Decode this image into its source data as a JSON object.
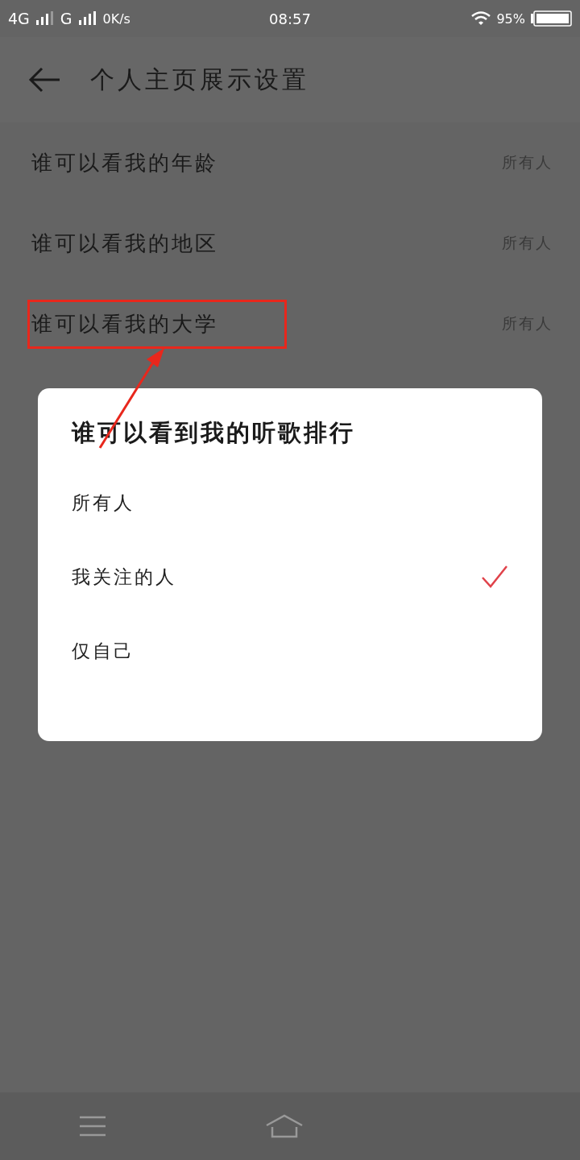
{
  "status_bar": {
    "network_1": "4G",
    "network_2": "G",
    "speed": "0K/s",
    "time": "08:57",
    "battery": "95%"
  },
  "header": {
    "title": "个人主页展示设置"
  },
  "rows": [
    {
      "label": "谁可以看我的年龄",
      "value": "所有人",
      "highlighted": false
    },
    {
      "label": "谁可以看我的地区",
      "value": "所有人",
      "highlighted": false
    },
    {
      "label": "谁可以看我的大学",
      "value": "所有人",
      "highlighted": true
    }
  ],
  "dialog": {
    "title": "谁可以看到我的听歌排行",
    "options": [
      {
        "label": "所有人",
        "selected": false
      },
      {
        "label": "我关注的人",
        "selected": true
      },
      {
        "label": "仅自己",
        "selected": false
      }
    ]
  }
}
